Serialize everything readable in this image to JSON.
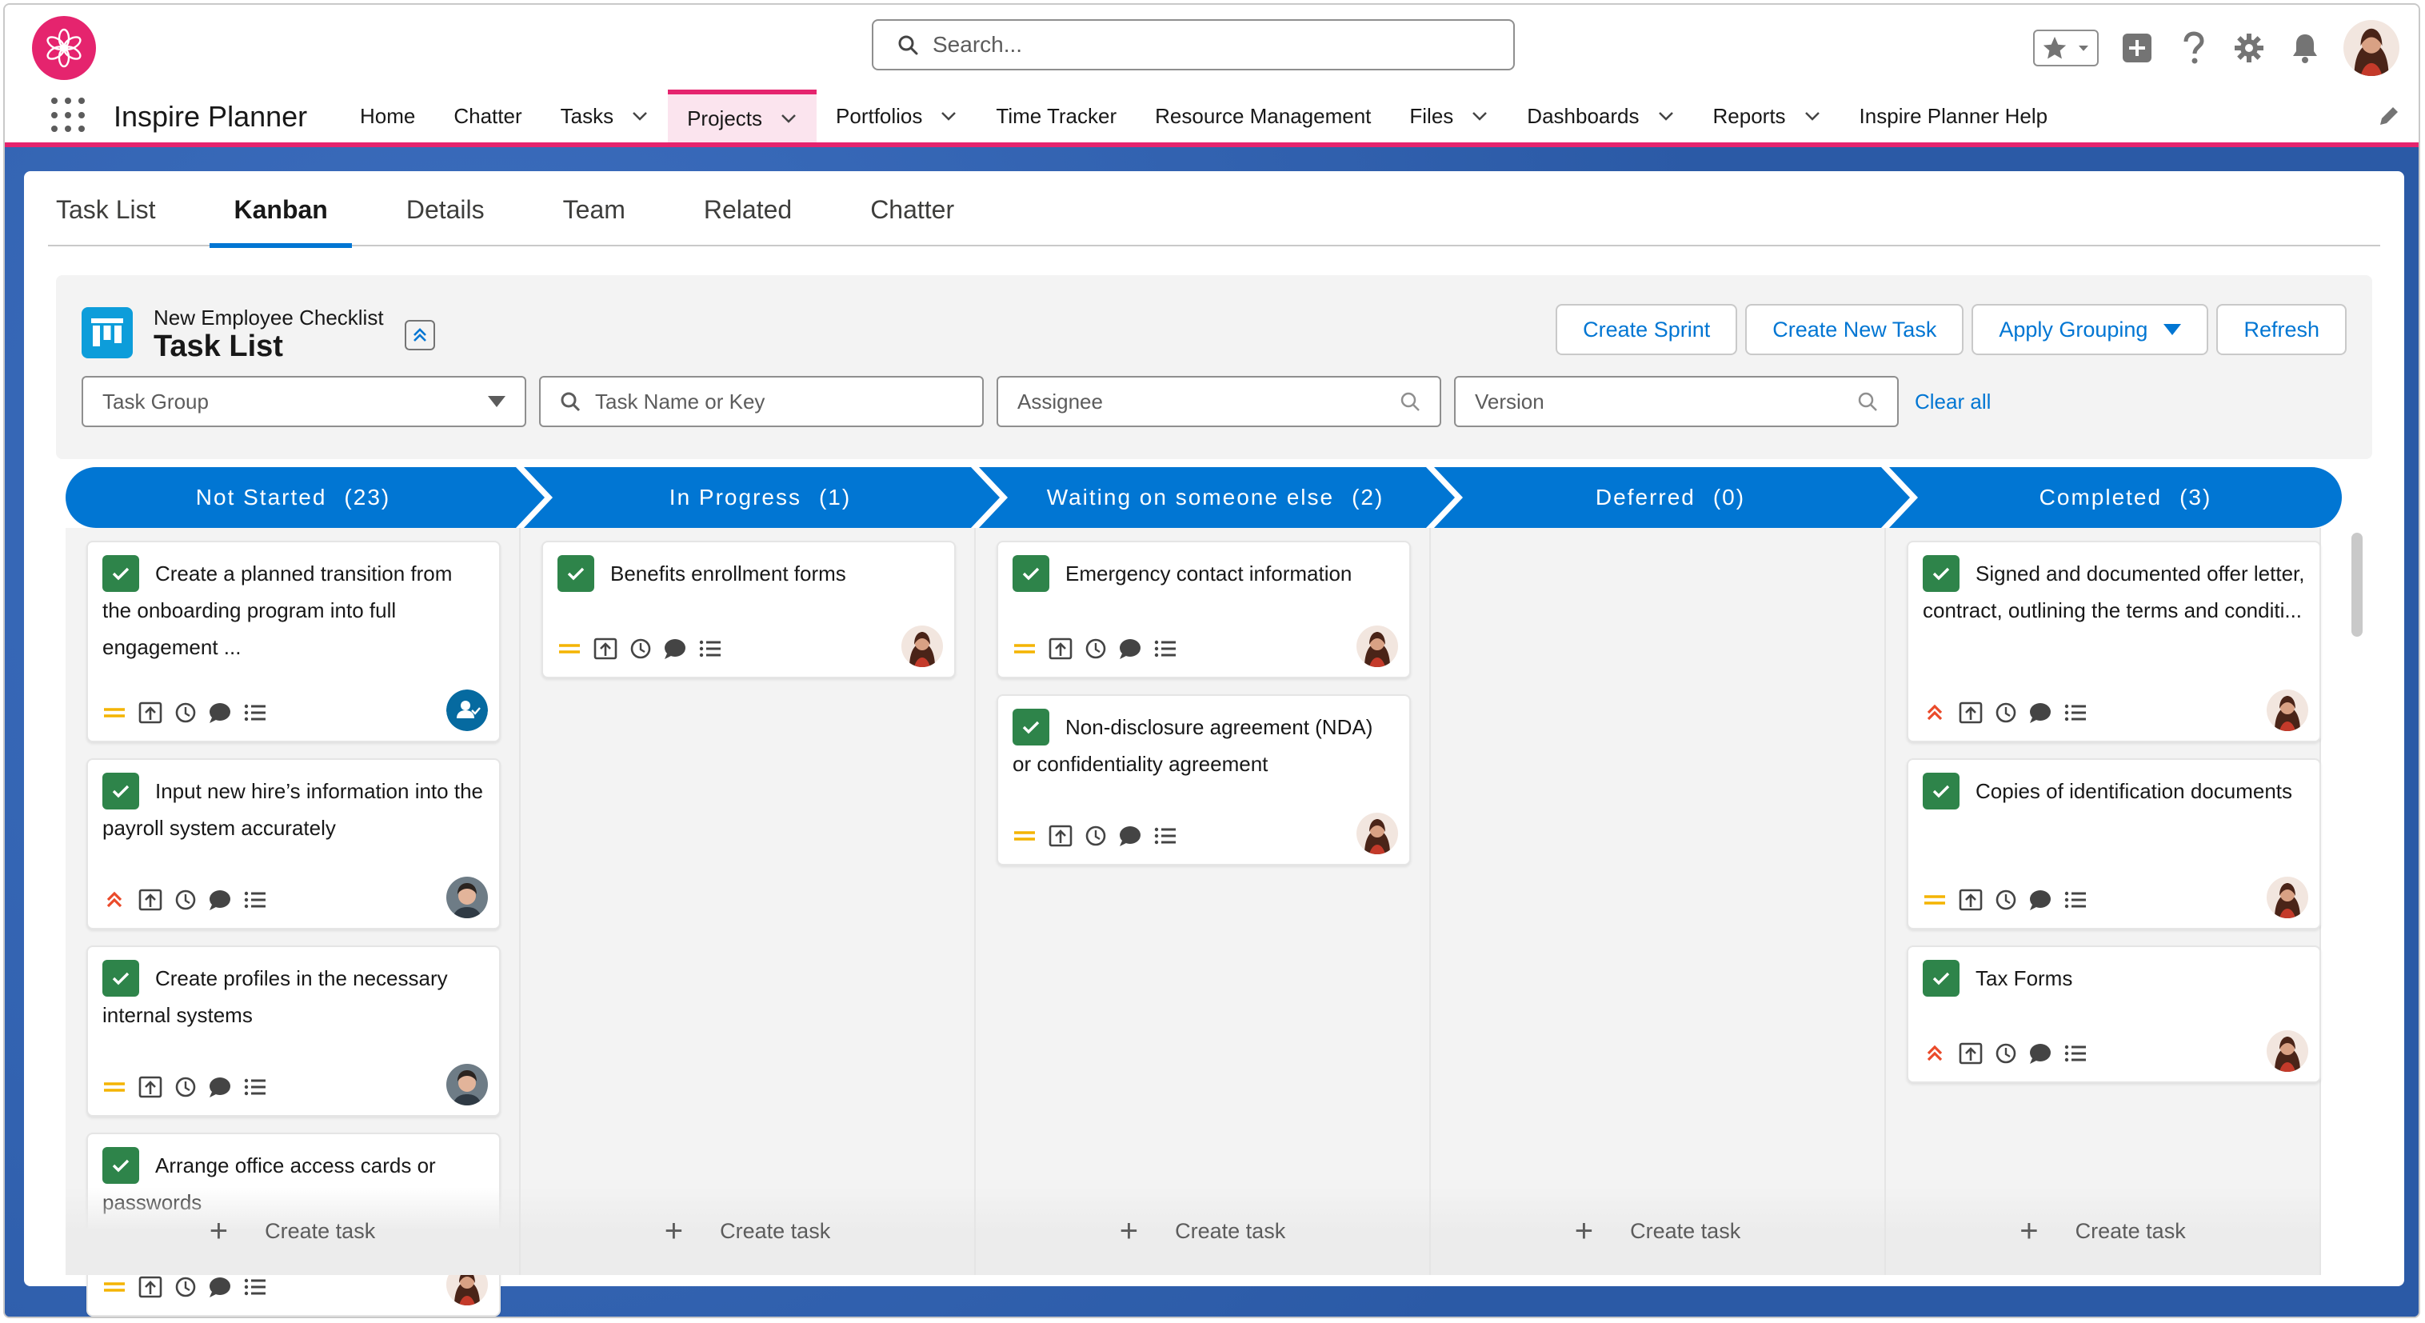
{
  "header": {
    "search_placeholder": "Search...",
    "app_name": "Inspire Planner"
  },
  "nav": {
    "items": [
      {
        "label": "Home",
        "dropdown": false,
        "active": false
      },
      {
        "label": "Chatter",
        "dropdown": false,
        "active": false
      },
      {
        "label": "Tasks",
        "dropdown": true,
        "active": false
      },
      {
        "label": "Projects",
        "dropdown": true,
        "active": true
      },
      {
        "label": "Portfolios",
        "dropdown": true,
        "active": false
      },
      {
        "label": "Time Tracker",
        "dropdown": false,
        "active": false
      },
      {
        "label": "Resource Management",
        "dropdown": false,
        "active": false
      },
      {
        "label": "Files",
        "dropdown": true,
        "active": false
      },
      {
        "label": "Dashboards",
        "dropdown": true,
        "active": false
      },
      {
        "label": "Reports",
        "dropdown": true,
        "active": false
      },
      {
        "label": "Inspire Planner Help",
        "dropdown": false,
        "active": false
      }
    ]
  },
  "tabs": [
    "Task List",
    "Kanban",
    "Details",
    "Team",
    "Related",
    "Chatter"
  ],
  "active_tab": "Kanban",
  "toolbar": {
    "breadcrumb": "New Employee Checklist",
    "title": "Task List",
    "buttons": {
      "create_sprint": "Create Sprint",
      "create_new_task": "Create New Task",
      "apply_grouping": "Apply Grouping",
      "refresh": "Refresh"
    },
    "filters": {
      "task_group": "Task Group",
      "task_name": "Task Name or Key",
      "assignee": "Assignee",
      "version": "Version",
      "clear_all": "Clear all"
    }
  },
  "colors": {
    "brand": "#e5246e",
    "accent": "#0176d3",
    "check": "#2e844a",
    "priority_medium": "#f4b400",
    "priority_high": "#ea4a2a"
  },
  "columns": [
    {
      "name": "Not Started",
      "count": "(23)",
      "cards": [
        {
          "title": "Create a planned transition from the onboarding program into full engagement ...",
          "priority": "medium",
          "assignee": "team-icon"
        },
        {
          "title": "Input new hire’s information into the payroll system accurately",
          "priority": "high",
          "assignee": "man"
        },
        {
          "title": "Create profiles in the necessary internal systems",
          "priority": "medium",
          "assignee": "man"
        },
        {
          "title": "Arrange office access cards or passwords",
          "priority": "medium",
          "assignee": "woman"
        }
      ]
    },
    {
      "name": "In Progress",
      "count": "(1)",
      "cards": [
        {
          "title": "Benefits enrollment forms",
          "priority": "medium",
          "assignee": "woman"
        }
      ]
    },
    {
      "name": "Waiting on someone else",
      "count": "(2)",
      "cards": [
        {
          "title": "Emergency contact information",
          "priority": "medium",
          "assignee": "woman"
        },
        {
          "title": "Non-disclosure agreement (NDA) or confidentiality agreement",
          "priority": "medium",
          "assignee": "woman"
        }
      ]
    },
    {
      "name": "Deferred",
      "count": "(0)",
      "cards": []
    },
    {
      "name": "Completed",
      "count": "(3)",
      "cards": [
        {
          "title": "Signed and documented offer letter, contract, outlining the terms and conditi...",
          "priority": "high",
          "assignee": "woman"
        },
        {
          "title": "Copies of identification documents",
          "priority": "medium",
          "assignee": "woman"
        },
        {
          "title": "Tax Forms",
          "priority": "high",
          "assignee": "woman"
        }
      ]
    }
  ],
  "create_task_label": "Create task"
}
